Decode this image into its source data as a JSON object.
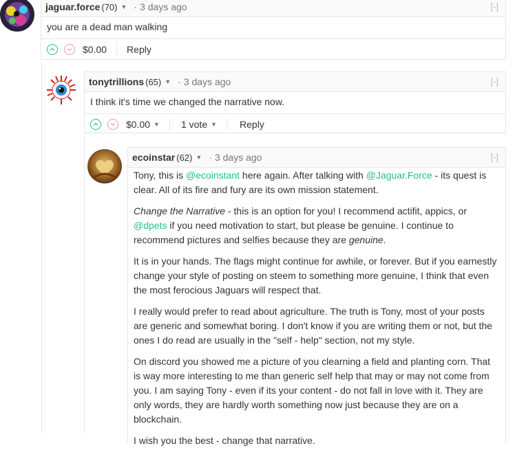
{
  "colors": {
    "accent": "#1fbf8f",
    "downvote": "#f0a0a0",
    "border": "#e6e6e6"
  },
  "comments": [
    {
      "author": "jaguar.force",
      "rep": "(70)",
      "time": "3 days ago",
      "collapse": "[-]",
      "body": "you are a dead man walking",
      "payout": "$0.00",
      "reply": "Reply"
    },
    {
      "author": "tonytrillions",
      "rep": "(65)",
      "time": "3 days ago",
      "collapse": "[-]",
      "body": "I think it's time we changed the narrative now.",
      "payout": "$0.00",
      "votes": "1 vote",
      "reply": "Reply"
    },
    {
      "author": "ecoinstar",
      "rep": "(62)",
      "time": "3 days ago",
      "collapse": "[-]",
      "p1_a": "Tony, this is ",
      "p1_m1": "@ecoinstant",
      "p1_b": " here again. After talking with ",
      "p1_m2": "@Jaguar.Force",
      "p1_c": " - its quest is clear. All of its fire and fury are its own mission statement.",
      "p2_em": "Change the Narrative",
      "p2_a": " - this is an option for you! I recommend actifit, appics, or ",
      "p2_m": "@dpets",
      "p2_b": " if you need motivation to start, but please be genuine. I continue to recommend pictures and selfies because they are ",
      "p2_em2": "genuine",
      "p2_c": ".",
      "p3": "It is in your hands. The flags might continue for awhile, or forever. But if you earnestly change your style of posting on steem to something more genuine, I think that even the most ferocious Jaguars will respect that.",
      "p4": "I really would prefer to read about agriculture. The truth is Tony, most of your posts are generic and somewhat boring. I don't know if you are writing them or not, but the ones I do read are usually in the \"self - help\" section, not my style.",
      "p5": "On discord you showed me a picture of you clearning a field and planting corn. That is way more interesting to me than generic self help that may or may not come from you. I am saying Tony - even if its your content - do not fall in love with it. They are only words, they are hardly worth something now just because they are on a blockchain.",
      "p6": "I wish you the best - change that narrative."
    }
  ]
}
